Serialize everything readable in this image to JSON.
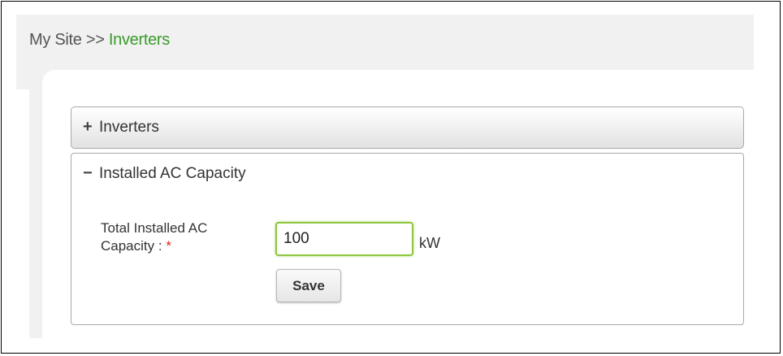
{
  "breadcrumb": {
    "root": "My Site",
    "separator": ">>",
    "current": "Inverters"
  },
  "panels": {
    "inverters": {
      "toggle": "+",
      "title": "Inverters"
    },
    "installed_ac_capacity": {
      "toggle": "−",
      "title": "Installed AC Capacity",
      "field": {
        "label_line1": "Total Installed AC",
        "label_line2": "Capacity :",
        "required_marker": "*",
        "value": "100",
        "unit": "kW"
      },
      "save_label": "Save"
    }
  },
  "colors": {
    "accent_green": "#3a9a2a",
    "input_focus_border": "#8cc63e",
    "required": "#dd2222"
  }
}
